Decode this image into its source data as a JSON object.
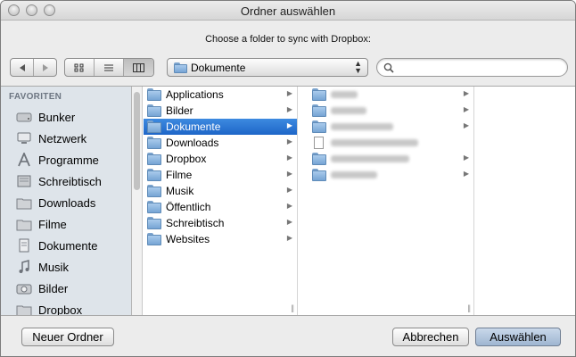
{
  "window": {
    "title": "Ordner auswählen"
  },
  "prompt": "Choose a folder to sync with Dropbox:",
  "toolbar": {
    "back_icon": "back-arrow-icon",
    "forward_icon": "forward-arrow-icon",
    "view_icons": [
      "icon-view-icon",
      "list-view-icon",
      "column-view-icon"
    ],
    "location_value": "Dokumente",
    "search_placeholder": ""
  },
  "sidebar": {
    "header": "FAVORITEN",
    "items": [
      {
        "label": "Bunker",
        "icon": "drive-icon"
      },
      {
        "label": "Netzwerk",
        "icon": "network-icon"
      },
      {
        "label": "Programme",
        "icon": "applications-icon"
      },
      {
        "label": "Schreibtisch",
        "icon": "desktop-icon"
      },
      {
        "label": "Downloads",
        "icon": "downloads-icon"
      },
      {
        "label": "Filme",
        "icon": "movies-icon"
      },
      {
        "label": "Dokumente",
        "icon": "documents-icon"
      },
      {
        "label": "Musik",
        "icon": "music-icon"
      },
      {
        "label": "Bilder",
        "icon": "pictures-icon"
      },
      {
        "label": "Dropbox",
        "icon": "dropbox-folder-icon"
      }
    ]
  },
  "column1": {
    "items": [
      {
        "label": "Applications"
      },
      {
        "label": "Bilder"
      },
      {
        "label": "Dokumente",
        "selected": true
      },
      {
        "label": "Downloads"
      },
      {
        "label": "Dropbox"
      },
      {
        "label": "Filme"
      },
      {
        "label": "Musik"
      },
      {
        "label": "Öffentlich"
      },
      {
        "label": "Schreibtisch"
      },
      {
        "label": "Websites"
      }
    ]
  },
  "buttons": {
    "new_folder": "Neuer Ordner",
    "cancel": "Abbrechen",
    "choose": "Auswählen"
  },
  "colors": {
    "selection": "#1e66c8",
    "sidebar_bg": "#dee4ea"
  }
}
